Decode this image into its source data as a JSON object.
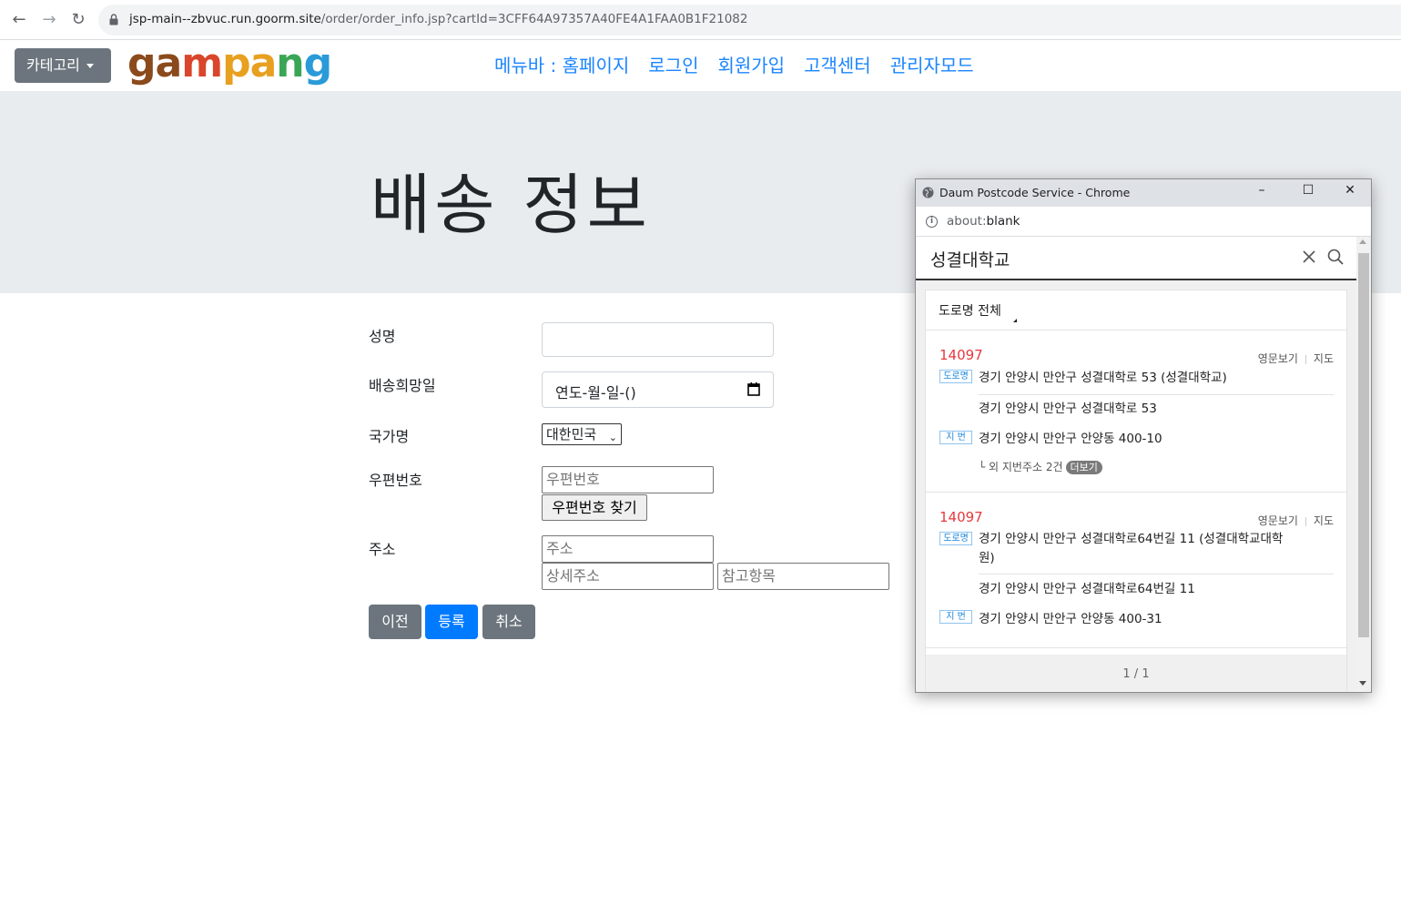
{
  "browser": {
    "url_host": "jsp-main--zbvuc.run.goorm.site",
    "url_path": "/order/order_info.jsp?cartId=3CFF64A97357A40FE4A1FAA0B1F21082"
  },
  "navbar": {
    "category_label": "카테고리",
    "logo": "gampang",
    "links": [
      "메뉴바 : 홈페이지",
      "로그인",
      "회원가입",
      "고객센터",
      "관리자모드"
    ]
  },
  "jumbotron": {
    "title": "배송 정보"
  },
  "form": {
    "name_label": "성명",
    "date_label": "배송희망일",
    "date_value": "연도-월-일-()",
    "country_label": "국가명",
    "country_value": "대한민국",
    "zip_label": "우편번호",
    "zip_placeholder": "우편번호",
    "zip_button": "우편번호 찾기",
    "address_label": "주소",
    "address_placeholder": "주소",
    "detail_placeholder": "상세주소",
    "extra_placeholder": "참고항목",
    "buttons": {
      "prev": "이전",
      "submit": "등록",
      "cancel": "취소"
    }
  },
  "popup": {
    "title": "Daum Postcode Service - Chrome",
    "address_prefix": "about:",
    "address_main": "blank",
    "search_query": "성결대학교",
    "filter_label": "도로명 전체",
    "english_link": "영문보기",
    "map_link": "지도",
    "road_tag": "도로명",
    "lot_tag": "지 번",
    "results": [
      {
        "zip": "14097",
        "road": "경기 안양시 만안구 성결대학로 53 (성결대학교)",
        "road_short": "경기 안양시 만안구 성결대학로 53",
        "lot": "경기 안양시 만안구 안양동 400-10",
        "more_text": "└ 외 지번주소 2건",
        "more_badge": "더보기"
      },
      {
        "zip": "14097",
        "road": "경기 안양시 만안구 성결대학로64번길 11 (성결대학교대학",
        "road_cont": "원)",
        "road_short": "경기 안양시 만안구 성결대학로64번길 11",
        "lot": "경기 안양시 만안구 안양동 400-31"
      }
    ],
    "pager": "1 / 1"
  },
  "colors": {
    "link_blue": "#1a85ff",
    "primary": "#007bff",
    "secondary": "#6c757d",
    "zip_red": "#e8383d"
  }
}
